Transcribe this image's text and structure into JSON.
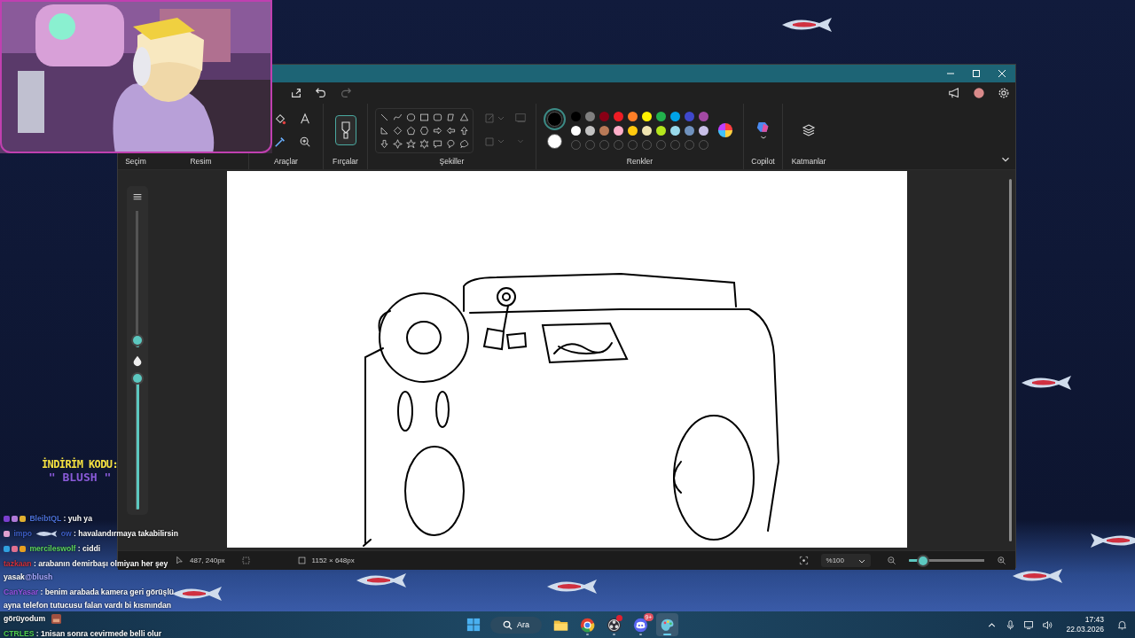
{
  "promo": {
    "title": "İNDİRİM KODU:",
    "code": "\" BLUSH \""
  },
  "chat": [
    {
      "badges": [
        {
          "color": "#7b3fd0"
        },
        {
          "color": "#b07ad8"
        },
        {
          "color": "#e0b030"
        }
      ],
      "user": "BleibtQL",
      "color": "#4a6fd6",
      "text": ": yuh ya"
    },
    {
      "badges": [
        {
          "color": "#e0a0d0"
        }
      ],
      "user": "impo",
      "user_tail": "ow",
      "color": "#3d5fc8",
      "text": ": havalandırmaya takabilirsin"
    },
    {
      "badges": [
        {
          "color": "#30a0e0"
        },
        {
          "color": "#e07090"
        },
        {
          "color": "#e8a020"
        }
      ],
      "user": "mercileswolf",
      "color": "#5cd65c",
      "text": ": ciddi"
    },
    {
      "user": "tazkaan",
      "color": "#d0303a",
      "text": ": arabanın demirbaşı olmiyan her şey yasak",
      "mention": "@blush"
    },
    {
      "user": "CanYasar",
      "color": "#9a55e8",
      "text": ": benim arabada kamera geri görüşlü ayna telefon tutucusu falan vardı bi kısmından görüyodum",
      "emote": true
    },
    {
      "user": "CTRLES",
      "color": "#50d050",
      "text": ": 1nisan sonra cevirmede belli olur"
    }
  ],
  "paint": {
    "ribbon_groups": [
      {
        "label": "Seçim",
        "kind": "hidden"
      },
      {
        "label": "Resim",
        "kind": "hidden"
      },
      {
        "label": "Araçlar",
        "kind": "tools"
      },
      {
        "label": "Fırçalar",
        "kind": "brushes"
      },
      {
        "label": "Şekiller",
        "kind": "shapes"
      },
      {
        "label": "Renkler",
        "kind": "colors"
      },
      {
        "label": "Copilot",
        "kind": "copilot"
      },
      {
        "label": "Katmanlar",
        "kind": "layers"
      }
    ],
    "current_colors": [
      {
        "color": "#000000",
        "selected": true
      },
      {
        "color": "#ffffff",
        "selected": false
      }
    ],
    "palette": [
      {
        "kind": "swatch",
        "color": "#000000"
      },
      {
        "kind": "swatch",
        "color": "#7f7f7f"
      },
      {
        "kind": "swatch",
        "color": "#880015"
      },
      {
        "kind": "swatch",
        "color": "#ed1c24"
      },
      {
        "kind": "swatch",
        "color": "#ff7f27"
      },
      {
        "kind": "swatch",
        "color": "#fff200"
      },
      {
        "kind": "swatch",
        "color": "#22b14c"
      },
      {
        "kind": "swatch",
        "color": "#00a2e8"
      },
      {
        "kind": "swatch",
        "color": "#3f48cc"
      },
      {
        "kind": "swatch",
        "color": "#a349a4"
      },
      {
        "kind": "swatch",
        "color": "#ffffff"
      },
      {
        "kind": "swatch",
        "color": "#c3c3c3"
      },
      {
        "kind": "swatch",
        "color": "#b97a57"
      },
      {
        "kind": "swatch",
        "color": "#ffaec9"
      },
      {
        "kind": "swatch",
        "color": "#ffc90e"
      },
      {
        "kind": "swatch",
        "color": "#efe4b0"
      },
      {
        "kind": "swatch",
        "color": "#b5e61d"
      },
      {
        "kind": "swatch",
        "color": "#99d9ea"
      },
      {
        "kind": "swatch",
        "color": "#7092be"
      },
      {
        "kind": "swatch",
        "color": "#c8bfe7"
      },
      {
        "kind": "empty"
      },
      {
        "kind": "empty"
      },
      {
        "kind": "empty"
      },
      {
        "kind": "empty"
      },
      {
        "kind": "empty"
      },
      {
        "kind": "empty"
      },
      {
        "kind": "empty"
      },
      {
        "kind": "empty"
      },
      {
        "kind": "empty"
      },
      {
        "kind": "empty"
      }
    ],
    "size_slider": {
      "level": 0.02
    },
    "opacity_slider": {
      "level": 1
    },
    "status": {
      "cursor": "487, 240px",
      "canvas_size": "1152 × 648px",
      "zoom": "%100"
    },
    "zoom_slider": {
      "level": 0.14
    }
  },
  "taskbar": {
    "search": "Ara",
    "apps": [
      {
        "kind": "folder",
        "running": false,
        "selected": false,
        "alert": false
      },
      {
        "kind": "chrome",
        "running": true,
        "selected": false,
        "alert": false
      },
      {
        "kind": "obs",
        "running": true,
        "selected": false,
        "alert": true
      },
      {
        "kind": "discord",
        "running": true,
        "selected": false,
        "alert": false,
        "badge": "9+"
      },
      {
        "kind": "paint",
        "running": true,
        "selected": true,
        "alert": false
      }
    ],
    "clock": {
      "time": "17:43",
      "date": "22.03.2026"
    }
  }
}
